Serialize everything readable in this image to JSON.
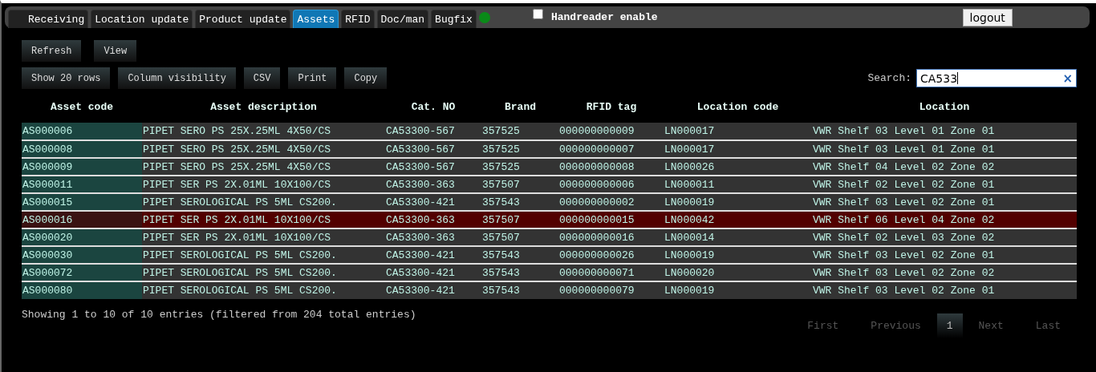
{
  "nav": {
    "tabs": [
      {
        "label": "Receiving",
        "selected": false
      },
      {
        "label": "Location update",
        "selected": false
      },
      {
        "label": "Product update",
        "selected": false
      },
      {
        "label": "Assets",
        "selected": true
      },
      {
        "label": "RFID",
        "selected": false
      },
      {
        "label": "Doc/man",
        "selected": false
      },
      {
        "label": "Bugfix",
        "selected": false
      }
    ],
    "handreader": {
      "label": "Handreader enable",
      "checked": false
    },
    "logout": "logout"
  },
  "toolbar": {
    "row_1": [
      "Refresh",
      "View"
    ],
    "row_2": [
      "Show 20 rows",
      "Column visibility",
      "CSV",
      "Print",
      "Copy"
    ]
  },
  "search": {
    "label": "Search:",
    "value": "CA533",
    "clear": "×"
  },
  "table": {
    "columns": [
      "Asset code",
      "Asset description",
      "Cat. NO",
      "Brand",
      "RFID tag",
      "Location code",
      "Location"
    ],
    "rows": [
      {
        "cells": [
          "AS000006",
          "PIPET SERO PS 25X.25ML 4X50/CS",
          "CA53300-567",
          "357525",
          "000000000009",
          "LN000017",
          "VWR Shelf 03 Level 01 Zone 01"
        ],
        "selected": false
      },
      {
        "cells": [
          "AS000008",
          "PIPET SERO PS 25X.25ML 4X50/CS",
          "CA53300-567",
          "357525",
          "000000000007",
          "LN000017",
          "VWR Shelf 03 Level 01 Zone 01"
        ],
        "selected": false
      },
      {
        "cells": [
          "AS000009",
          "PIPET SERO PS 25X.25ML 4X50/CS",
          "CA53300-567",
          "357525",
          "000000000008",
          "LN000026",
          "VWR Shelf 04 Level 02 Zone 02"
        ],
        "selected": false
      },
      {
        "cells": [
          "AS000011",
          "PIPET SER PS 2X.01ML 10X100/CS",
          "CA53300-363",
          "357507",
          "000000000006",
          "LN000011",
          "VWR Shelf 02 Level 02 Zone 01"
        ],
        "selected": false
      },
      {
        "cells": [
          "AS000015",
          "PIPET SEROLOGICAL PS 5ML CS200.",
          "CA53300-421",
          "357543",
          "000000000002",
          "LN000019",
          "VWR Shelf 03 Level 02 Zone 01"
        ],
        "selected": false
      },
      {
        "cells": [
          "AS000016",
          "PIPET SER PS 2X.01ML 10X100/CS",
          "CA53300-363",
          "357507",
          "000000000015",
          "LN000042",
          "VWR Shelf 06 Level 04 Zone 02"
        ],
        "selected": true
      },
      {
        "cells": [
          "AS000020",
          "PIPET SER PS 2X.01ML 10X100/CS",
          "CA53300-363",
          "357507",
          "000000000016",
          "LN000014",
          "VWR Shelf 02 Level 03 Zone 02"
        ],
        "selected": false
      },
      {
        "cells": [
          "AS000030",
          "PIPET SEROLOGICAL PS 5ML CS200.",
          "CA53300-421",
          "357543",
          "000000000026",
          "LN000019",
          "VWR Shelf 03 Level 02 Zone 01"
        ],
        "selected": false
      },
      {
        "cells": [
          "AS000072",
          "PIPET SEROLOGICAL PS 5ML CS200.",
          "CA53300-421",
          "357543",
          "000000000071",
          "LN000020",
          "VWR Shelf 03 Level 02 Zone 02"
        ],
        "selected": false
      },
      {
        "cells": [
          "AS000080",
          "PIPET SEROLOGICAL PS 5ML CS200.",
          "CA53300-421",
          "357543",
          "000000000079",
          "LN000019",
          "VWR Shelf 03 Level 02 Zone 01"
        ],
        "selected": false
      }
    ]
  },
  "info": "Showing 1 to 10 of 10 entries (filtered from 204 total entries)",
  "pagination": [
    {
      "label": "First",
      "kind": "link",
      "disabled": true,
      "selected": false
    },
    {
      "label": "Previous",
      "kind": "link",
      "disabled": true,
      "selected": false
    },
    {
      "label": "1",
      "kind": "page",
      "disabled": false,
      "selected": true
    },
    {
      "label": "Next",
      "kind": "link",
      "disabled": true,
      "selected": false
    },
    {
      "label": "Last",
      "kind": "link",
      "disabled": true,
      "selected": false
    }
  ]
}
